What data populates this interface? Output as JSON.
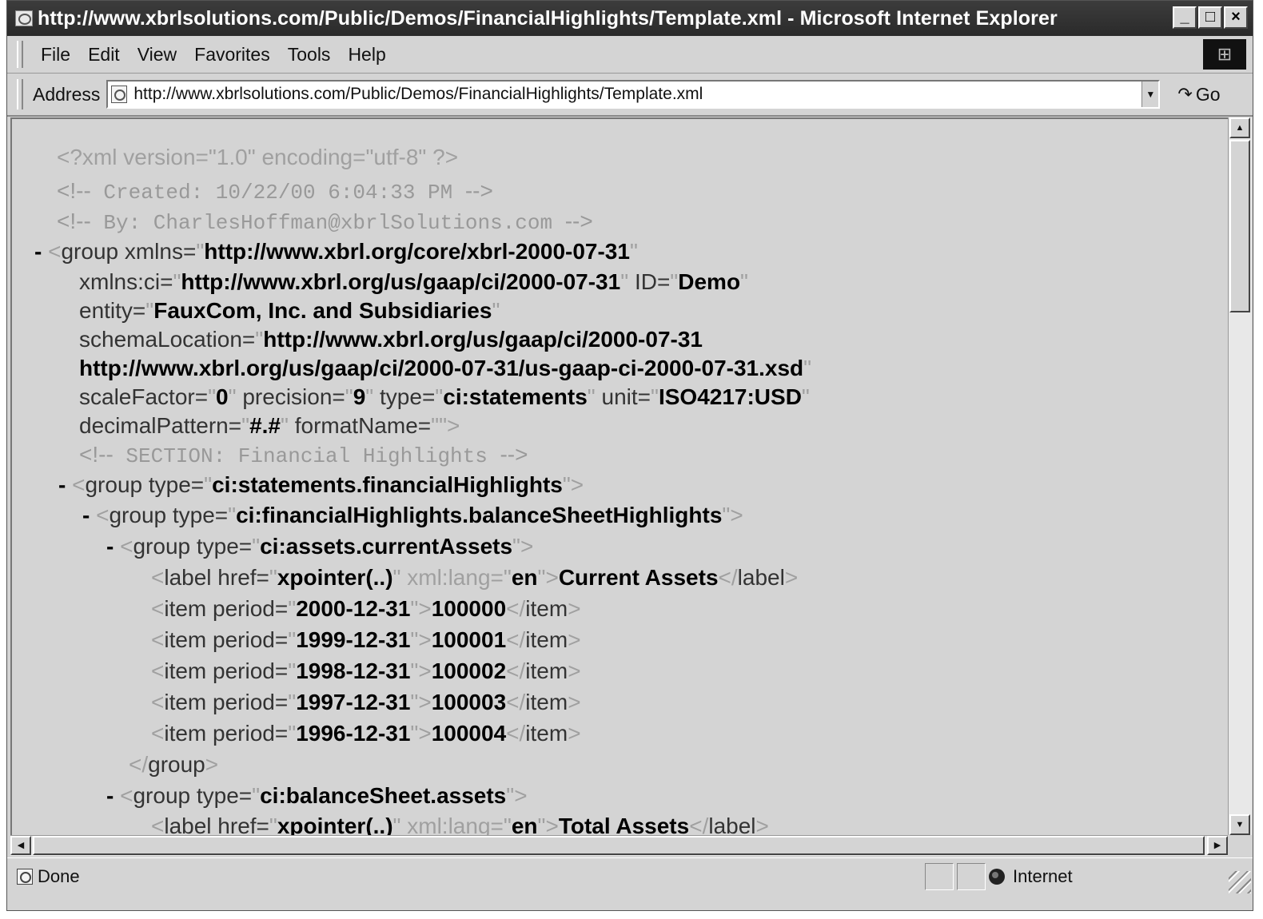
{
  "window": {
    "title": "http://www.xbrlsolutions.com/Public/Demos/FinancialHighlights/Template.xml - Microsoft Internet Explorer",
    "minimize": "_",
    "maximize": "□",
    "close": "×"
  },
  "menu": [
    "File",
    "Edit",
    "View",
    "Favorites",
    "Tools",
    "Help"
  ],
  "address": {
    "label": "Address",
    "url": "http://www.xbrlsolutions.com/Public/Demos/FinancialHighlights/Template.xml",
    "go": "Go"
  },
  "xml": {
    "decl": "<?xml version=\"1.0\" encoding=\"utf-8\" ?>",
    "comment_created": " Created: 10/22/00 6:04:33 PM  ",
    "comment_by": " By: CharlesHoffman@xbrlSolutions.com  ",
    "group_root": {
      "xmlns": "http://www.xbrl.org/core/xbrl-2000-07-31",
      "xmlns_ci": "http://www.xbrl.org/us/gaap/ci/2000-07-31",
      "id": "Demo",
      "entity": "FauxCom, Inc. and Subsidiaries",
      "schema_loc_1": "http://www.xbrl.org/us/gaap/ci/2000-07-31",
      "schema_loc_2": "http://www.xbrl.org/us/gaap/ci/2000-07-31/us-gaap-ci-2000-07-31.xsd",
      "scale_factor": "0",
      "precision": "9",
      "type": "ci:statements",
      "unit": "ISO4217:USD",
      "decimal_pattern": "#.#",
      "format_name": ""
    },
    "comment_section": " SECTION:  Financial Highlights  ",
    "group_fh": "ci:statements.financialHighlights",
    "group_bsh": "ci:financialHighlights.balanceSheetHighlights",
    "group_ca": "ci:assets.currentAssets",
    "label_ca": {
      "href": "xpointer(..)",
      "lang": "en",
      "text": "Current Assets"
    },
    "items": [
      {
        "period": "2000-12-31",
        "value": "100000"
      },
      {
        "period": "1999-12-31",
        "value": "100001"
      },
      {
        "period": "1998-12-31",
        "value": "100002"
      },
      {
        "period": "1997-12-31",
        "value": "100003"
      },
      {
        "period": "1996-12-31",
        "value": "100004"
      }
    ],
    "close_group": "</group>",
    "group_assets": "ci:balanceSheet.assets",
    "label_ta": {
      "href": "xpointer(..)",
      "lang": "en",
      "text": "Total Assets"
    }
  },
  "status": {
    "text": "Done",
    "zone": "Internet"
  }
}
